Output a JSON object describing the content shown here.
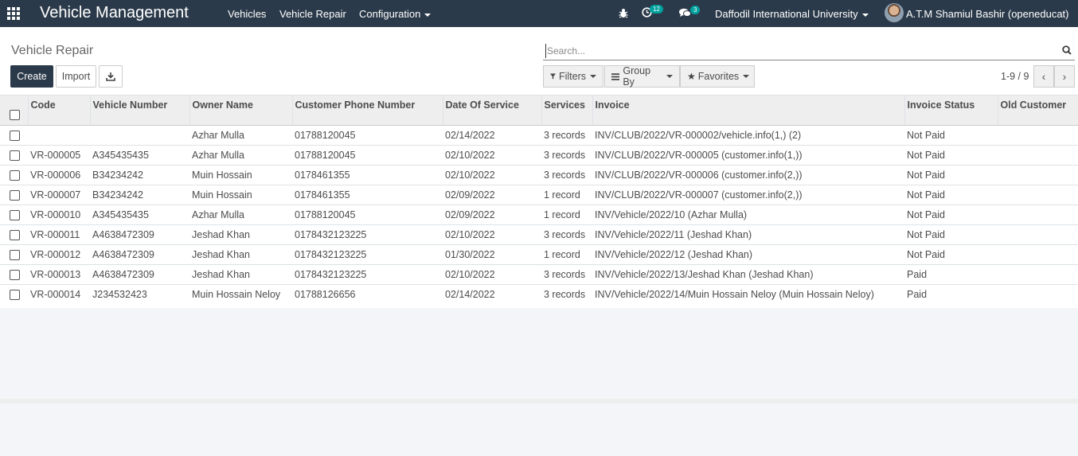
{
  "navbar": {
    "app_title": "Vehicle Management",
    "menu": [
      {
        "label": "Vehicles"
      },
      {
        "label": "Vehicle Repair"
      },
      {
        "label": "Configuration"
      }
    ],
    "activity_count": "12",
    "message_count": "3",
    "company": "Daffodil International University",
    "user_name": "A.T.M Shamiul Bashir (openeducat)"
  },
  "control": {
    "breadcrumb": "Vehicle Repair",
    "create_label": "Create",
    "import_label": "Import",
    "search_placeholder": "Search...",
    "filters_label": "Filters",
    "groupby_label": "Group By",
    "favorites_label": "Favorites",
    "pager": "1-9 / 9"
  },
  "table": {
    "columns": [
      "Code",
      "Vehicle Number",
      "Owner Name",
      "Customer Phone Number",
      "Date Of Service",
      "Services",
      "Invoice",
      "Invoice Status",
      "Old Customer"
    ],
    "rows": [
      [
        "",
        "",
        "Azhar Mulla",
        "01788120045",
        "02/14/2022",
        "3 records",
        "INV/CLUB/2022/VR-000002/vehicle.info(1,) (2)",
        "Not Paid",
        ""
      ],
      [
        "VR-000005",
        "A345435435",
        "Azhar Mulla",
        "01788120045",
        "02/10/2022",
        "3 records",
        "INV/CLUB/2022/VR-000005 (customer.info(1,))",
        "Not Paid",
        ""
      ],
      [
        "VR-000006",
        "B34234242",
        "Muin Hossain",
        "0178461355",
        "02/10/2022",
        "3 records",
        "INV/CLUB/2022/VR-000006 (customer.info(2,))",
        "Not Paid",
        ""
      ],
      [
        "VR-000007",
        "B34234242",
        "Muin Hossain",
        "0178461355",
        "02/09/2022",
        "1 record",
        "INV/CLUB/2022/VR-000007 (customer.info(2,))",
        "Not Paid",
        ""
      ],
      [
        "VR-000010",
        "A345435435",
        "Azhar Mulla",
        "01788120045",
        "02/09/2022",
        "1 record",
        "INV/Vehicle/2022/10 (Azhar Mulla)",
        "Not Paid",
        ""
      ],
      [
        "VR-000011",
        "A4638472309",
        "Jeshad Khan",
        "0178432123225",
        "02/10/2022",
        "3 records",
        "INV/Vehicle/2022/11 (Jeshad Khan)",
        "Not Paid",
        ""
      ],
      [
        "VR-000012",
        "A4638472309",
        "Jeshad Khan",
        "0178432123225",
        "01/30/2022",
        "1 record",
        "INV/Vehicle/2022/12 (Jeshad Khan)",
        "Not Paid",
        ""
      ],
      [
        "VR-000013",
        "A4638472309",
        "Jeshad Khan",
        "0178432123225",
        "02/10/2022",
        "3 records",
        "INV/Vehicle/2022/13/Jeshad Khan (Jeshad Khan)",
        "Paid",
        ""
      ],
      [
        "VR-000014",
        "J234532423",
        "Muin Hossain Neloy",
        "01788126656",
        "02/14/2022",
        "3 records",
        "INV/Vehicle/2022/14/Muin Hossain Neloy (Muin Hossain Neloy)",
        "Paid",
        ""
      ]
    ]
  }
}
